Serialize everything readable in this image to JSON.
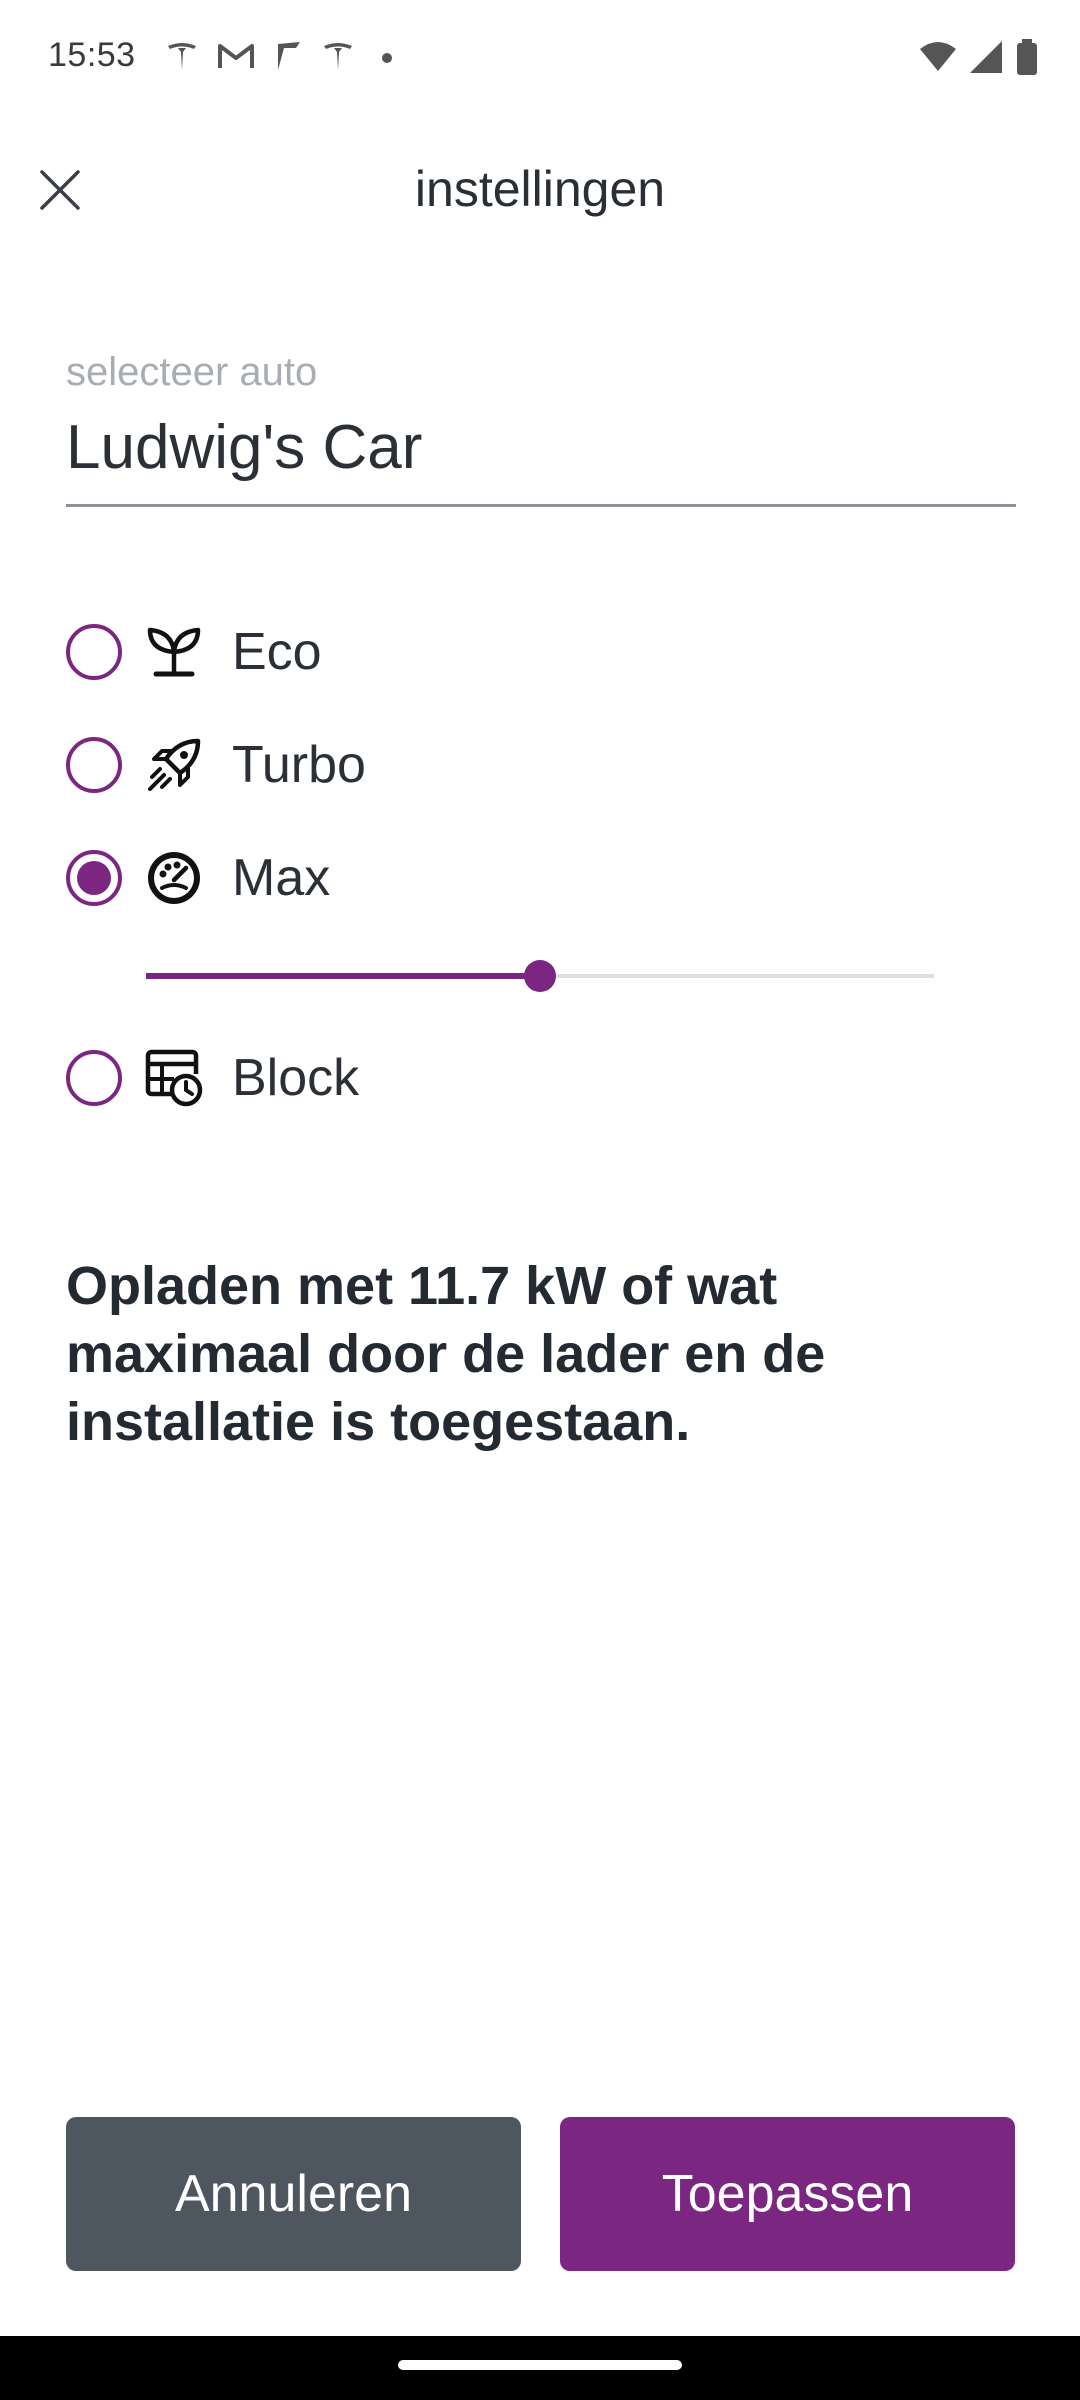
{
  "status_bar": {
    "time": "15:53",
    "notification_icons": [
      "tesla-icon",
      "gmail-icon",
      "arrow-app-icon",
      "tesla-icon",
      "dot-icon"
    ],
    "system_icons": [
      "wifi-icon",
      "cellular-icon",
      "battery-icon"
    ]
  },
  "header": {
    "title": "instellingen",
    "close_icon": "close-icon"
  },
  "car_select": {
    "label": "selecteer auto",
    "value": "Ludwig's Car"
  },
  "charge_modes": {
    "selected": "Max",
    "options": [
      {
        "label": "Eco",
        "icon": "sprout-icon",
        "selected": false
      },
      {
        "label": "Turbo",
        "icon": "rocket-icon",
        "selected": false
      },
      {
        "label": "Max",
        "icon": "speedometer-face-icon",
        "selected": true
      },
      {
        "label": "Block",
        "icon": "calendar-clock-icon",
        "selected": false
      }
    ],
    "max_slider_fraction": 0.5
  },
  "description": "Opladen met 11.7 kW of wat maximaal door de lader en de installatie is toegestaan.",
  "buttons": {
    "cancel": "Annuleren",
    "apply": "Toepassen"
  },
  "colors": {
    "accent": "#7b2781",
    "cancel_button": "#4e5760",
    "text": "#2b3036"
  }
}
